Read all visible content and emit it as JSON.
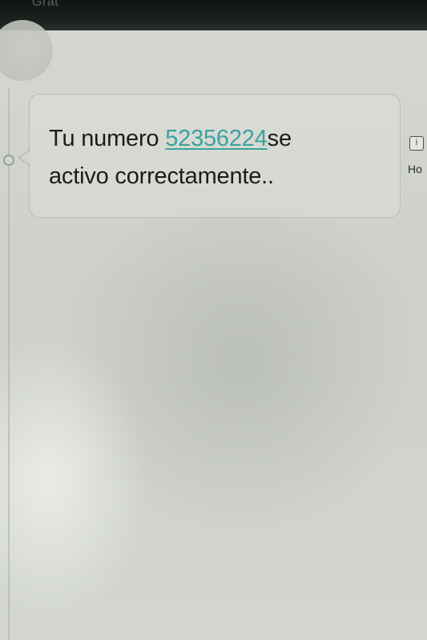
{
  "status_bar": {
    "text": "Grat"
  },
  "message": {
    "prefix": "Tu numero ",
    "phone_number": "52356224",
    "suffix_line1": "se",
    "line2": "activo correctamente.."
  },
  "side_panel": {
    "icon": "info-icon",
    "label": "Ho"
  },
  "colors": {
    "link": "#3aa3a0",
    "text": "#1b1d1c",
    "top_bar": "#1d2522"
  }
}
